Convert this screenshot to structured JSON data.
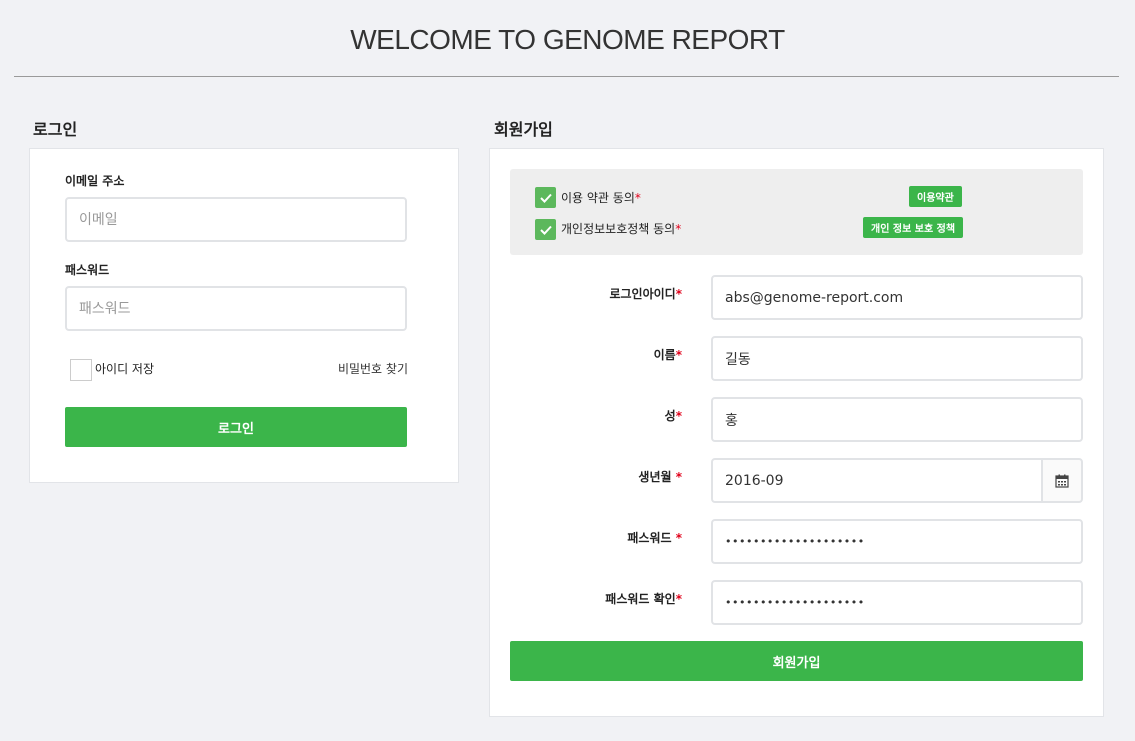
{
  "header": {
    "title": "WELCOME TO GENOME REPORT"
  },
  "login": {
    "heading": "로그인",
    "email_label": "이메일 주소",
    "email_placeholder": "이메일",
    "password_label": "패스워드",
    "password_placeholder": "패스워드",
    "remember_label": "아이디 저장",
    "find_password_link": "비밀번호 찾기",
    "submit_label": "로그인"
  },
  "signup": {
    "heading": "회원가입",
    "terms": {
      "agree_terms_label": "이용 약관 동의",
      "agree_privacy_label": "개인정보보호정책 동의",
      "required_mark": "*",
      "terms_button": "이용약관",
      "privacy_button": "개인 정보 보호 정책"
    },
    "fields": {
      "login_id_label": "로그인아이디",
      "login_id_value": "abs@genome-report.com",
      "first_name_label": "이름",
      "first_name_value": "길동",
      "last_name_label": "성",
      "last_name_value": "홍",
      "birth_label": "생년월 ",
      "birth_value": "2016-09",
      "password_label": "패스워드 ",
      "password_value": "••••••••••••••••••••",
      "password_confirm_label": "패스워드 확인",
      "password_confirm_value": "••••••••••••••••••••"
    },
    "submit_label": "회원가입"
  },
  "icons": {
    "calendar": "calendar-icon",
    "check": "check-icon"
  },
  "colors": {
    "accent": "#3bb54a",
    "checkbox": "#5cb85c",
    "required": "#e0001a",
    "background": "#f1f2f5"
  }
}
